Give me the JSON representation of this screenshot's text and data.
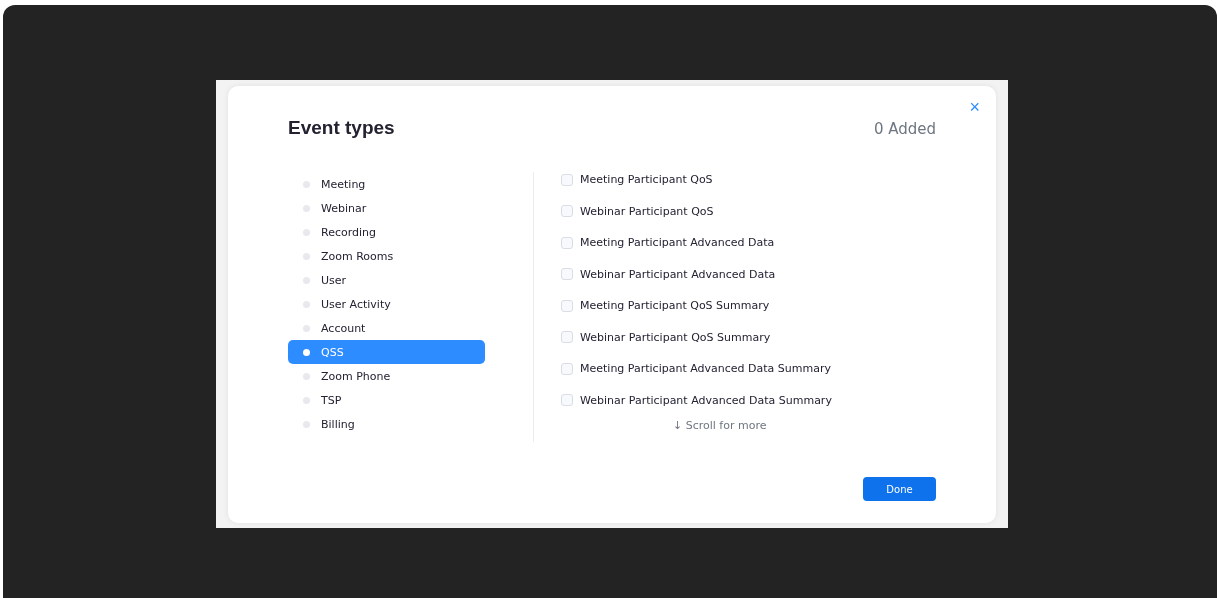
{
  "dialog": {
    "title": "Event types",
    "added_count": "0 Added",
    "close": "×",
    "categories": [
      {
        "label": "Meeting",
        "selected": false
      },
      {
        "label": "Webinar",
        "selected": false
      },
      {
        "label": "Recording",
        "selected": false
      },
      {
        "label": "Zoom Rooms",
        "selected": false
      },
      {
        "label": "User",
        "selected": false
      },
      {
        "label": "User Activity",
        "selected": false
      },
      {
        "label": "Account",
        "selected": false
      },
      {
        "label": "QSS",
        "selected": true
      },
      {
        "label": "Zoom Phone",
        "selected": false
      },
      {
        "label": "TSP",
        "selected": false
      },
      {
        "label": "Billing",
        "selected": false
      }
    ],
    "events": [
      {
        "label": "Meeting Participant QoS",
        "checked": false
      },
      {
        "label": "Webinar Participant QoS",
        "checked": false
      },
      {
        "label": "Meeting Participant Advanced Data",
        "checked": false
      },
      {
        "label": "Webinar Participant Advanced Data",
        "checked": false
      },
      {
        "label": "Meeting Participant QoS Summary",
        "checked": false
      },
      {
        "label": "Webinar Participant QoS Summary",
        "checked": false
      },
      {
        "label": "Meeting Participant Advanced Data Summary",
        "checked": false
      },
      {
        "label": "Webinar Participant Advanced Data Summary",
        "checked": false
      }
    ],
    "scroll_hint": "↓ Scroll for more",
    "done_button": "Done"
  }
}
